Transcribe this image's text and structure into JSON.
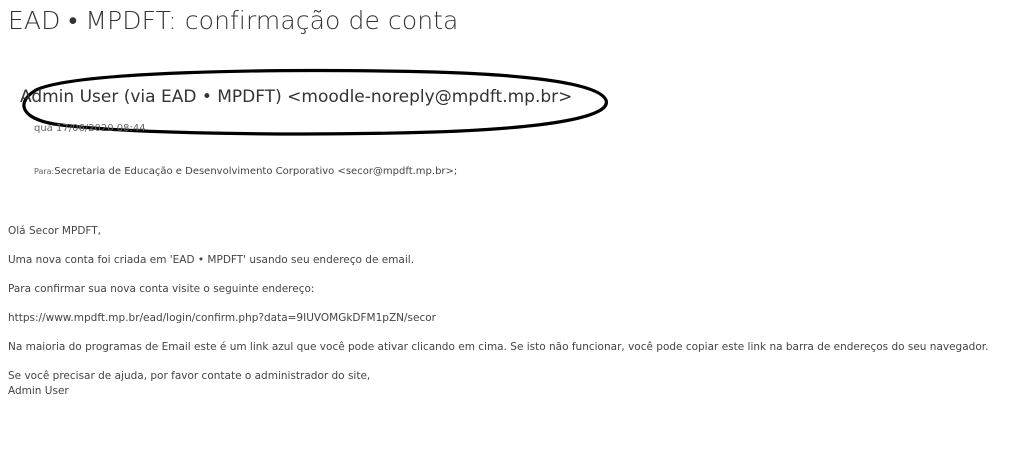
{
  "email": {
    "subject": "EAD • MPDFT: confirmação de conta",
    "sender": "Admin User (via EAD • MPDFT) <moodle-noreply@mpdft.mp.br>",
    "date": "qua 17/06/2020 08:44",
    "to_label": "Para:",
    "to_value": "Secretaria de Educação e Desenvolvimento Corporativo <secor@mpdft.mp.br>;",
    "body": {
      "greeting": "Olá Secor MPDFT,",
      "line1": "Uma nova conta foi criada em 'EAD • MPDFT' usando seu endereço de email.",
      "line2": "Para confirmar sua nova conta visite o seguinte endereço:",
      "link": "https://www.mpdft.mp.br/ead/login/confirm.php?data=9IUVOMGkDFM1pZN/secor",
      "line3": "Na maioria do programas de Email este é um link azul que você pode ativar clicando em cima. Se isto não funcionar, você pode copiar este link na barra de endereços do seu navegador.",
      "line4": "Se você precisar de ajuda, por favor contate o administrador do site,",
      "signature": "Admin User"
    }
  },
  "colors": {
    "text": "#333333",
    "annotation_ink": "#000000"
  }
}
